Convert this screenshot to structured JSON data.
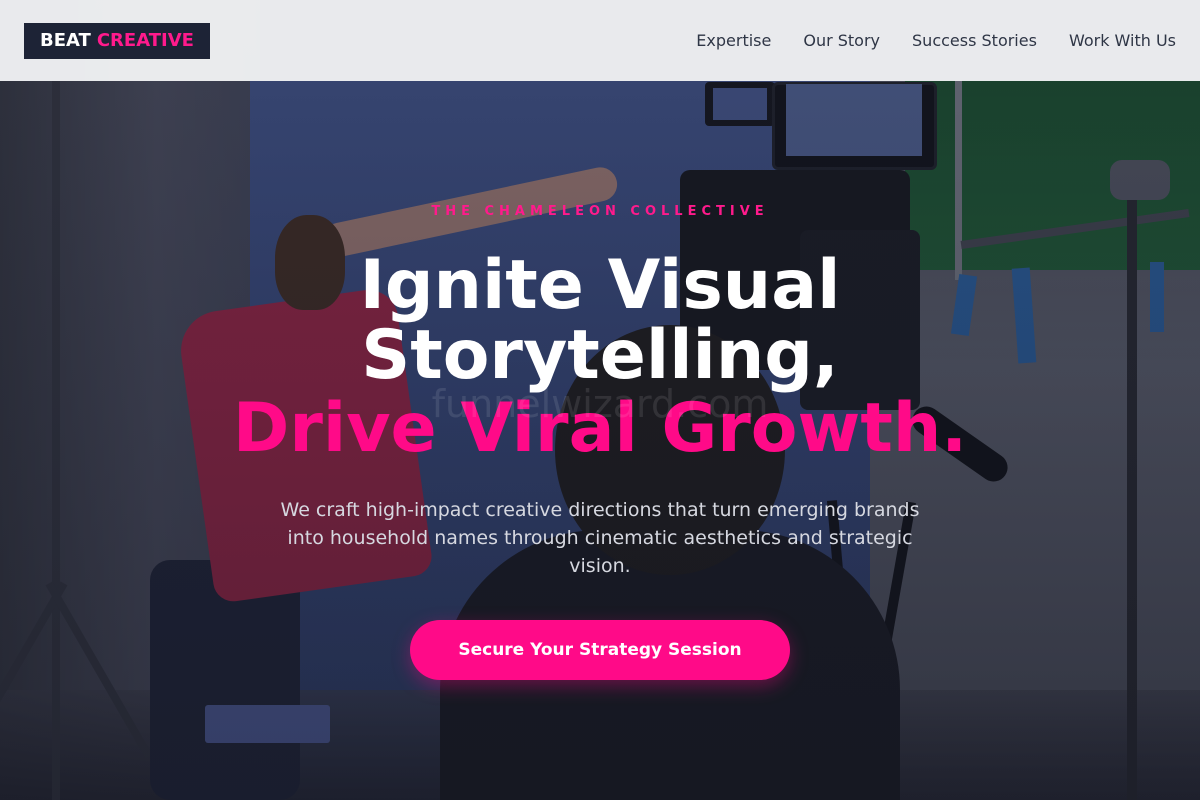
{
  "header": {
    "logo": {
      "part1": "BEAT",
      "part2": "CREATIVE"
    },
    "nav": [
      {
        "label": "Expertise"
      },
      {
        "label": "Our Story"
      },
      {
        "label": "Success Stories"
      },
      {
        "label": "Work With Us"
      }
    ]
  },
  "hero": {
    "eyebrow": "THE CHAMELEON COLLECTIVE",
    "headline_line1": "Ignite Visual",
    "headline_line2": "Storytelling,",
    "headline_line3": "Drive Viral Growth.",
    "watermark": "funnelwizard.com",
    "subtitle": "We craft high-impact creative directions that turn emerging brands into household names through cinematic aesthetics and strategic vision.",
    "cta_label": "Secure Your Strategy Session",
    "background_image": "film-studio-crew-with-camera"
  },
  "colors": {
    "accent": "#ff0a88",
    "logo_bg": "#1d2336",
    "header_bg": "#f0f1f3",
    "nav_text": "#2f3646"
  }
}
